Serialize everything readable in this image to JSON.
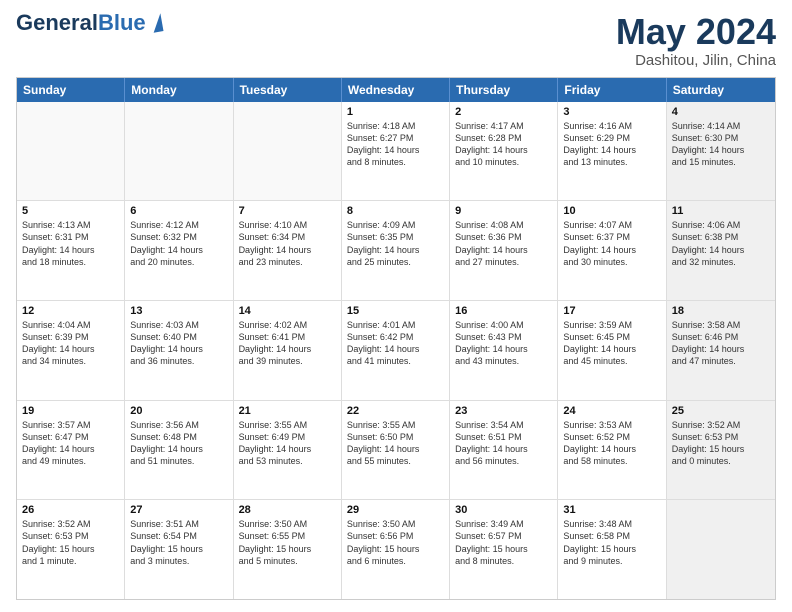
{
  "header": {
    "logo_line1": "General",
    "logo_line2": "Blue",
    "title": "May 2024",
    "subtitle": "Dashitou, Jilin, China"
  },
  "calendar": {
    "days_of_week": [
      "Sunday",
      "Monday",
      "Tuesday",
      "Wednesday",
      "Thursday",
      "Friday",
      "Saturday"
    ],
    "rows": [
      [
        {
          "day": "",
          "info": "",
          "empty": true
        },
        {
          "day": "",
          "info": "",
          "empty": true
        },
        {
          "day": "",
          "info": "",
          "empty": true
        },
        {
          "day": "1",
          "info": "Sunrise: 4:18 AM\nSunset: 6:27 PM\nDaylight: 14 hours\nand 8 minutes.",
          "empty": false
        },
        {
          "day": "2",
          "info": "Sunrise: 4:17 AM\nSunset: 6:28 PM\nDaylight: 14 hours\nand 10 minutes.",
          "empty": false
        },
        {
          "day": "3",
          "info": "Sunrise: 4:16 AM\nSunset: 6:29 PM\nDaylight: 14 hours\nand 13 minutes.",
          "empty": false
        },
        {
          "day": "4",
          "info": "Sunrise: 4:14 AM\nSunset: 6:30 PM\nDaylight: 14 hours\nand 15 minutes.",
          "empty": false,
          "shaded": true
        }
      ],
      [
        {
          "day": "5",
          "info": "Sunrise: 4:13 AM\nSunset: 6:31 PM\nDaylight: 14 hours\nand 18 minutes.",
          "empty": false
        },
        {
          "day": "6",
          "info": "Sunrise: 4:12 AM\nSunset: 6:32 PM\nDaylight: 14 hours\nand 20 minutes.",
          "empty": false
        },
        {
          "day": "7",
          "info": "Sunrise: 4:10 AM\nSunset: 6:34 PM\nDaylight: 14 hours\nand 23 minutes.",
          "empty": false
        },
        {
          "day": "8",
          "info": "Sunrise: 4:09 AM\nSunset: 6:35 PM\nDaylight: 14 hours\nand 25 minutes.",
          "empty": false
        },
        {
          "day": "9",
          "info": "Sunrise: 4:08 AM\nSunset: 6:36 PM\nDaylight: 14 hours\nand 27 minutes.",
          "empty": false
        },
        {
          "day": "10",
          "info": "Sunrise: 4:07 AM\nSunset: 6:37 PM\nDaylight: 14 hours\nand 30 minutes.",
          "empty": false
        },
        {
          "day": "11",
          "info": "Sunrise: 4:06 AM\nSunset: 6:38 PM\nDaylight: 14 hours\nand 32 minutes.",
          "empty": false,
          "shaded": true
        }
      ],
      [
        {
          "day": "12",
          "info": "Sunrise: 4:04 AM\nSunset: 6:39 PM\nDaylight: 14 hours\nand 34 minutes.",
          "empty": false
        },
        {
          "day": "13",
          "info": "Sunrise: 4:03 AM\nSunset: 6:40 PM\nDaylight: 14 hours\nand 36 minutes.",
          "empty": false
        },
        {
          "day": "14",
          "info": "Sunrise: 4:02 AM\nSunset: 6:41 PM\nDaylight: 14 hours\nand 39 minutes.",
          "empty": false
        },
        {
          "day": "15",
          "info": "Sunrise: 4:01 AM\nSunset: 6:42 PM\nDaylight: 14 hours\nand 41 minutes.",
          "empty": false
        },
        {
          "day": "16",
          "info": "Sunrise: 4:00 AM\nSunset: 6:43 PM\nDaylight: 14 hours\nand 43 minutes.",
          "empty": false
        },
        {
          "day": "17",
          "info": "Sunrise: 3:59 AM\nSunset: 6:45 PM\nDaylight: 14 hours\nand 45 minutes.",
          "empty": false
        },
        {
          "day": "18",
          "info": "Sunrise: 3:58 AM\nSunset: 6:46 PM\nDaylight: 14 hours\nand 47 minutes.",
          "empty": false,
          "shaded": true
        }
      ],
      [
        {
          "day": "19",
          "info": "Sunrise: 3:57 AM\nSunset: 6:47 PM\nDaylight: 14 hours\nand 49 minutes.",
          "empty": false
        },
        {
          "day": "20",
          "info": "Sunrise: 3:56 AM\nSunset: 6:48 PM\nDaylight: 14 hours\nand 51 minutes.",
          "empty": false
        },
        {
          "day": "21",
          "info": "Sunrise: 3:55 AM\nSunset: 6:49 PM\nDaylight: 14 hours\nand 53 minutes.",
          "empty": false
        },
        {
          "day": "22",
          "info": "Sunrise: 3:55 AM\nSunset: 6:50 PM\nDaylight: 14 hours\nand 55 minutes.",
          "empty": false
        },
        {
          "day": "23",
          "info": "Sunrise: 3:54 AM\nSunset: 6:51 PM\nDaylight: 14 hours\nand 56 minutes.",
          "empty": false
        },
        {
          "day": "24",
          "info": "Sunrise: 3:53 AM\nSunset: 6:52 PM\nDaylight: 14 hours\nand 58 minutes.",
          "empty": false
        },
        {
          "day": "25",
          "info": "Sunrise: 3:52 AM\nSunset: 6:53 PM\nDaylight: 15 hours\nand 0 minutes.",
          "empty": false,
          "shaded": true
        }
      ],
      [
        {
          "day": "26",
          "info": "Sunrise: 3:52 AM\nSunset: 6:53 PM\nDaylight: 15 hours\nand 1 minute.",
          "empty": false
        },
        {
          "day": "27",
          "info": "Sunrise: 3:51 AM\nSunset: 6:54 PM\nDaylight: 15 hours\nand 3 minutes.",
          "empty": false
        },
        {
          "day": "28",
          "info": "Sunrise: 3:50 AM\nSunset: 6:55 PM\nDaylight: 15 hours\nand 5 minutes.",
          "empty": false
        },
        {
          "day": "29",
          "info": "Sunrise: 3:50 AM\nSunset: 6:56 PM\nDaylight: 15 hours\nand 6 minutes.",
          "empty": false
        },
        {
          "day": "30",
          "info": "Sunrise: 3:49 AM\nSunset: 6:57 PM\nDaylight: 15 hours\nand 8 minutes.",
          "empty": false
        },
        {
          "day": "31",
          "info": "Sunrise: 3:48 AM\nSunset: 6:58 PM\nDaylight: 15 hours\nand 9 minutes.",
          "empty": false
        },
        {
          "day": "",
          "info": "",
          "empty": true,
          "shaded": true
        }
      ]
    ]
  }
}
